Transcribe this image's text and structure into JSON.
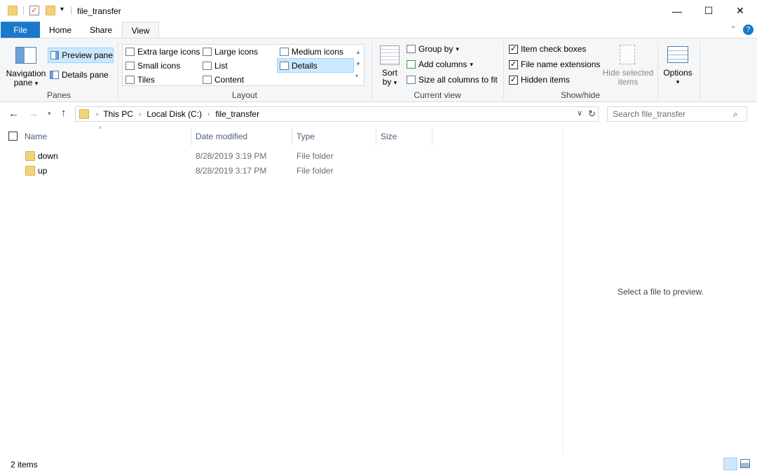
{
  "window": {
    "title": "file_transfer",
    "minimize_glyph": "—",
    "maximize_glyph": "☐",
    "close_glyph": "✕"
  },
  "tabs": [
    {
      "label": "File"
    },
    {
      "label": "Home"
    },
    {
      "label": "Share"
    },
    {
      "label": "View"
    }
  ],
  "ribbon": {
    "panes": {
      "navigation_pane": "Navigation",
      "navigation_pane_2": "pane",
      "preview_pane": "Preview pane",
      "details_pane": "Details pane",
      "group_label": "Panes"
    },
    "layout": {
      "items": [
        "Extra large icons",
        "Large icons",
        "Medium icons",
        "Small icons",
        "List",
        "Details",
        "Tiles",
        "Content"
      ],
      "group_label": "Layout"
    },
    "current_view": {
      "sort_by_1": "Sort",
      "sort_by_2": "by",
      "group_by": "Group by",
      "add_columns": "Add columns",
      "size_all": "Size all columns to fit",
      "group_label": "Current view"
    },
    "show_hide": {
      "item_check_boxes": "Item check boxes",
      "file_name_extensions": "File name extensions",
      "hidden_items": "Hidden items",
      "hide_selected_1": "Hide selected",
      "hide_selected_2": "items",
      "group_label": "Show/hide"
    },
    "options": {
      "label": "Options"
    }
  },
  "address": {
    "crumbs": [
      "This PC",
      "Local Disk (C:)",
      "file_transfer"
    ],
    "search_placeholder": "Search file_transfer"
  },
  "columns": [
    "Name",
    "Date modified",
    "Type",
    "Size"
  ],
  "files": [
    {
      "name": "down",
      "date": "8/28/2019 3:19 PM",
      "type": "File folder",
      "size": ""
    },
    {
      "name": "up",
      "date": "8/28/2019 3:17 PM",
      "type": "File folder",
      "size": ""
    }
  ],
  "preview": {
    "message": "Select a file to preview."
  },
  "status": {
    "count": "2 items"
  },
  "colors": {
    "accent": "#1979ca",
    "folder": "#f3d378",
    "selected": "#cce8ff"
  }
}
